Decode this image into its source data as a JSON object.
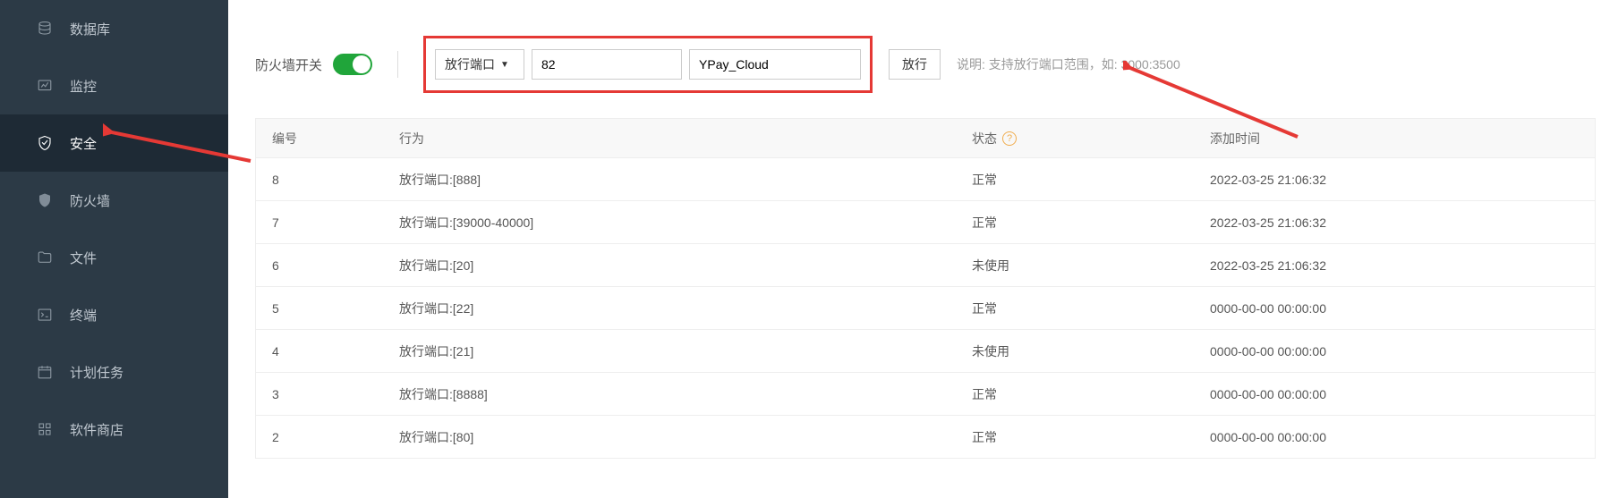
{
  "sidebar": {
    "items": [
      {
        "label": "数据库",
        "icon": "database-icon"
      },
      {
        "label": "监控",
        "icon": "monitor-icon"
      },
      {
        "label": "安全",
        "icon": "shield-icon",
        "active": true
      },
      {
        "label": "防火墙",
        "icon": "firewall-icon"
      },
      {
        "label": "文件",
        "icon": "folder-icon"
      },
      {
        "label": "终端",
        "icon": "terminal-icon"
      },
      {
        "label": "计划任务",
        "icon": "calendar-icon"
      },
      {
        "label": "软件商店",
        "icon": "apps-icon"
      }
    ]
  },
  "toolbar": {
    "firewall_label": "防火墙开关",
    "toggle_on": true,
    "select_label": "放行端口",
    "port_value": "82",
    "name_value": "YPay_Cloud",
    "submit_label": "放行",
    "hint_text": "说明: 支持放行端口范围，如: 3000:3500"
  },
  "table": {
    "headers": {
      "id": "编号",
      "action": "行为",
      "status": "状态",
      "time": "添加时间"
    },
    "rows": [
      {
        "id": "8",
        "action": "放行端口:[888]",
        "status": "正常",
        "time": "2022-03-25 21:06:32"
      },
      {
        "id": "7",
        "action": "放行端口:[39000-40000]",
        "status": "正常",
        "time": "2022-03-25 21:06:32"
      },
      {
        "id": "6",
        "action": "放行端口:[20]",
        "status": "未使用",
        "time": "2022-03-25 21:06:32"
      },
      {
        "id": "5",
        "action": "放行端口:[22]",
        "status": "正常",
        "time": "0000-00-00 00:00:00"
      },
      {
        "id": "4",
        "action": "放行端口:[21]",
        "status": "未使用",
        "time": "0000-00-00 00:00:00"
      },
      {
        "id": "3",
        "action": "放行端口:[8888]",
        "status": "正常",
        "time": "0000-00-00 00:00:00"
      },
      {
        "id": "2",
        "action": "放行端口:[80]",
        "status": "正常",
        "time": "0000-00-00 00:00:00"
      }
    ]
  }
}
